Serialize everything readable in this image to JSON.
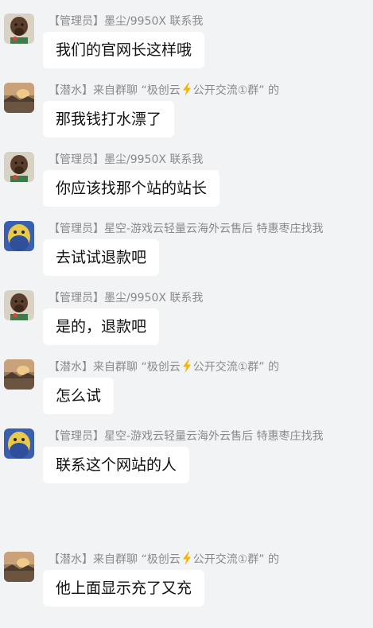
{
  "messages": [
    {
      "sender": "【管理员】墨尘/9950X 联系我",
      "text": "我们的官网长这样哦"
    },
    {
      "sender_pre": "【潜水】来自群聊 “极创云",
      "sender_post": "公开交流①群” 的",
      "text": "那我钱打水漂了"
    },
    {
      "sender": "【管理员】墨尘/9950X 联系我",
      "text": "你应该找那个站的站长"
    },
    {
      "sender": "【管理员】星空-游戏云轻量云海外云售后 特惠枣庄找我",
      "text": "去试试退款吧"
    },
    {
      "sender": "【管理员】墨尘/9950X 联系我",
      "text": "是的，退款吧"
    },
    {
      "sender_pre": "【潜水】来自群聊 “极创云",
      "sender_post": "公开交流①群” 的",
      "text": "怎么试"
    },
    {
      "sender": "【管理员】星空-游戏云轻量云海外云售后 特惠枣庄找我",
      "text": "联系这个网站的人"
    },
    {
      "sender_pre": "【潜水】来自群聊 “极创云",
      "sender_post": "公开交流①群” 的",
      "text": "他上面显示充了又充"
    }
  ],
  "colors": {
    "background": "#f2f3f5",
    "bubble": "#ffffff",
    "sender_text": "#8a8a8a",
    "lightning": "#f5b400"
  }
}
